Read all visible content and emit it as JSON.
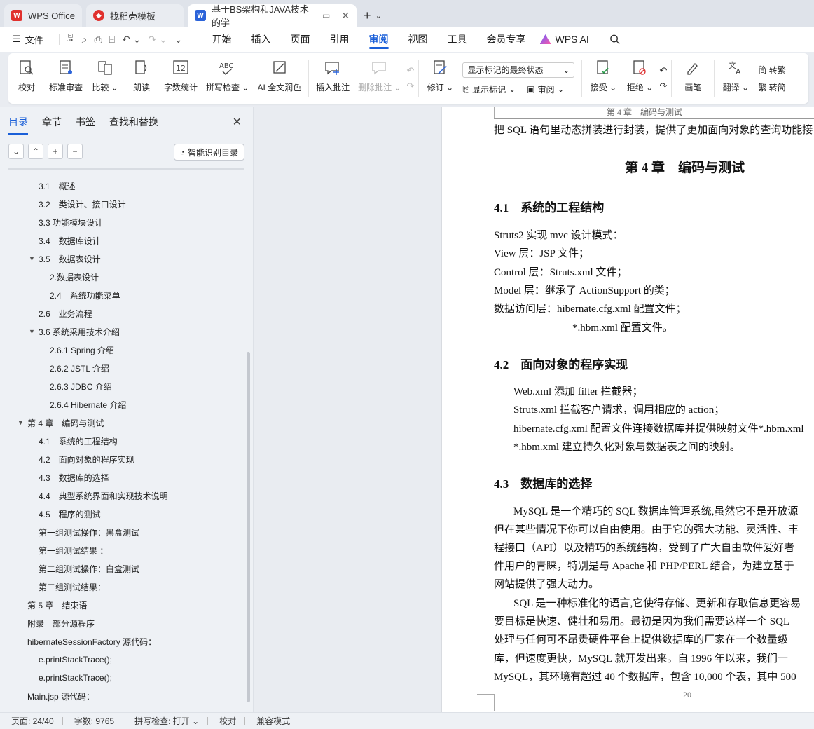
{
  "tabs": [
    {
      "label": "WPS Office",
      "icon": "wps-logo-icon",
      "color": "#e0312e"
    },
    {
      "label": "找稻壳模板",
      "icon": "docer-icon",
      "color": "#e0312e"
    },
    {
      "label": "基于BS架构和JAVA技术的学",
      "icon": "word-doc-icon",
      "color": "#2b63d9"
    }
  ],
  "menubar": {
    "file_label": "文件",
    "menus": [
      "开始",
      "插入",
      "页面",
      "引用",
      "审阅",
      "视图",
      "工具",
      "会员专享"
    ],
    "active_menu": "审阅",
    "ai_label": "WPS AI"
  },
  "ribbon": {
    "proofread": "校对",
    "std_review": "标准审查",
    "compare": "比较",
    "read_aloud": "朗读",
    "word_count": "字数统计",
    "spell_check": "拼写检查",
    "ai_polish": "AI 全文润色",
    "insert_comment": "插入批注",
    "delete_comment": "删除批注",
    "revise": "修订",
    "markup_combo": "显示标记的最终状态",
    "show_markup": "显示标记",
    "review": "审阅",
    "accept": "接受",
    "reject": "拒绝",
    "pen": "画笔",
    "translate": "翻译",
    "to_traditional": "简 转繁",
    "to_simplified": "繁 转简"
  },
  "nav": {
    "tabs": [
      "目录",
      "章节",
      "书签",
      "查找和替换"
    ],
    "smart_btn": "智能识别目录",
    "outline": [
      {
        "text": "3.1　概述",
        "level": 2,
        "tri": ""
      },
      {
        "text": "3.2　类设计、接口设计",
        "level": 2,
        "tri": ""
      },
      {
        "text": "3.3 功能模块设计",
        "level": 2,
        "tri": ""
      },
      {
        "text": "3.4　数据库设计",
        "level": 2,
        "tri": ""
      },
      {
        "text": "3.5　数据表设计",
        "level": 2,
        "tri": "▼"
      },
      {
        "text": "2.数据表设计",
        "level": 3,
        "tri": ""
      },
      {
        "text": "2.4　系统功能菜单",
        "level": 3,
        "tri": ""
      },
      {
        "text": "2.6　业务流程",
        "level": 2,
        "tri": ""
      },
      {
        "text": "3.6 系统采用技术介绍",
        "level": 2,
        "tri": "▼"
      },
      {
        "text": "2.6.1 Spring 介绍",
        "level": 3,
        "tri": ""
      },
      {
        "text": "2.6.2 JSTL 介绍",
        "level": 3,
        "tri": ""
      },
      {
        "text": "2.6.3 JDBC 介绍",
        "level": 3,
        "tri": ""
      },
      {
        "text": "2.6.4 Hibernate 介绍",
        "level": 3,
        "tri": ""
      },
      {
        "text": "第 4 章　编码与测试",
        "level": 1,
        "tri": "▼"
      },
      {
        "text": "4.1　系统的工程结构",
        "level": 2,
        "tri": ""
      },
      {
        "text": "4.2　面向对象的程序实现",
        "level": 2,
        "tri": ""
      },
      {
        "text": "4.3　数据库的选择",
        "level": 2,
        "tri": ""
      },
      {
        "text": "4.4　典型系统界面和实现技术说明",
        "level": 2,
        "tri": ""
      },
      {
        "text": "4.5　程序的测试",
        "level": 2,
        "tri": ""
      },
      {
        "text": "第一组测试操作：黑盒测试",
        "level": 2,
        "tri": ""
      },
      {
        "text": "第一组测试结果 ：",
        "level": 2,
        "tri": ""
      },
      {
        "text": "第二组测试操作：白盒测试",
        "level": 2,
        "tri": ""
      },
      {
        "text": "第二组测试结果：",
        "level": 2,
        "tri": ""
      },
      {
        "text": "第 5 章　结束语",
        "level": 1,
        "tri": ""
      },
      {
        "text": "附录　部分源程序",
        "level": 1,
        "tri": ""
      },
      {
        "text": "hibernateSessionFactory 源代码：",
        "level": 1,
        "tri": ""
      },
      {
        "text": "e.printStackTrace();",
        "level": 2,
        "tri": ""
      },
      {
        "text": "e.printStackTrace();",
        "level": 2,
        "tri": ""
      },
      {
        "text": "Main.jsp 源代码：",
        "level": 1,
        "tri": ""
      }
    ]
  },
  "doc": {
    "running_header": "第 4 章　编码与测试",
    "lines": [
      {
        "text": "把 SQL 语句里动态拼装进行封装，提供了更加面向对象的查询功能接口。",
        "kind": "p"
      },
      {
        "text": "第 4 章　编码与测试",
        "kind": "ch"
      },
      {
        "text": "4.1　系统的工程结构",
        "kind": "h2"
      },
      {
        "text": "Struts2 实现 mvc 设计模式：",
        "kind": "p"
      },
      {
        "text": "View 层：JSP 文件；",
        "kind": "p"
      },
      {
        "text": "Control 层：Struts.xml 文件；",
        "kind": "p"
      },
      {
        "text": "Model 层：继承了 ActionSupport 的类；",
        "kind": "p"
      },
      {
        "text": "数据访问层：hibernate.cfg.xml 配置文件；",
        "kind": "p"
      },
      {
        "text": "*.hbm.xml 配置文件。",
        "kind": "p2"
      },
      {
        "text": "4.2　面向对象的程序实现",
        "kind": "h2"
      },
      {
        "text": "Web.xml 添加 filter 拦截器；",
        "kind": "ind"
      },
      {
        "text": "Struts.xml 拦截客户请求，调用相应的 action；",
        "kind": "ind"
      },
      {
        "text": "hibernate.cfg.xml 配置文件连接数据库并提供映射文件*.hbm.xml",
        "kind": "ind"
      },
      {
        "text": "*.hbm.xml 建立持久化对象与数据表之间的映射。",
        "kind": "ind"
      },
      {
        "text": "4.3　数据库的选择",
        "kind": "h2"
      },
      {
        "text": "MySQL 是一个精巧的 SQL 数据库管理系统,虽然它不是开放源",
        "kind": "ind"
      },
      {
        "text": "但在某些情况下你可以自由使用。由于它的强大功能、灵活性、丰",
        "kind": "p"
      },
      {
        "text": "程接口（API）以及精巧的系统结构，受到了广大自由软件爱好者",
        "kind": "p"
      },
      {
        "text": "件用户的青睐，特别是与 Apache 和 PHP/PERL 结合，为建立基于",
        "kind": "p"
      },
      {
        "text": "网站提供了强大动力。",
        "kind": "p"
      },
      {
        "text": "SQL 是一种标准化的语言,它使得存储、更新和存取信息更容易",
        "kind": "ind"
      },
      {
        "text": "要目标是快速、健壮和易用。最初是因为我们需要这样一个 SQL",
        "kind": "p"
      },
      {
        "text": "处理与任何可不昂贵硬件平台上提供数据库的厂家在一个数量级",
        "kind": "p"
      },
      {
        "text": "库，但速度更快，MySQL 就开发出来。自 1996 年以来，我们一",
        "kind": "p"
      },
      {
        "text": "MySQL，其环境有超过 40 个数据库，包含 10,000 个表，其中 500",
        "kind": "p"
      }
    ],
    "page_number": "20"
  },
  "status": {
    "page": "页面: 24/40",
    "words": "字数: 9765",
    "spell": "拼写检查: 打开",
    "proof": "校对",
    "compat": "兼容模式"
  },
  "colors": {
    "accent": "#1a5fd8",
    "wps_red": "#e0312e",
    "doc_blue": "#2b63d9"
  }
}
